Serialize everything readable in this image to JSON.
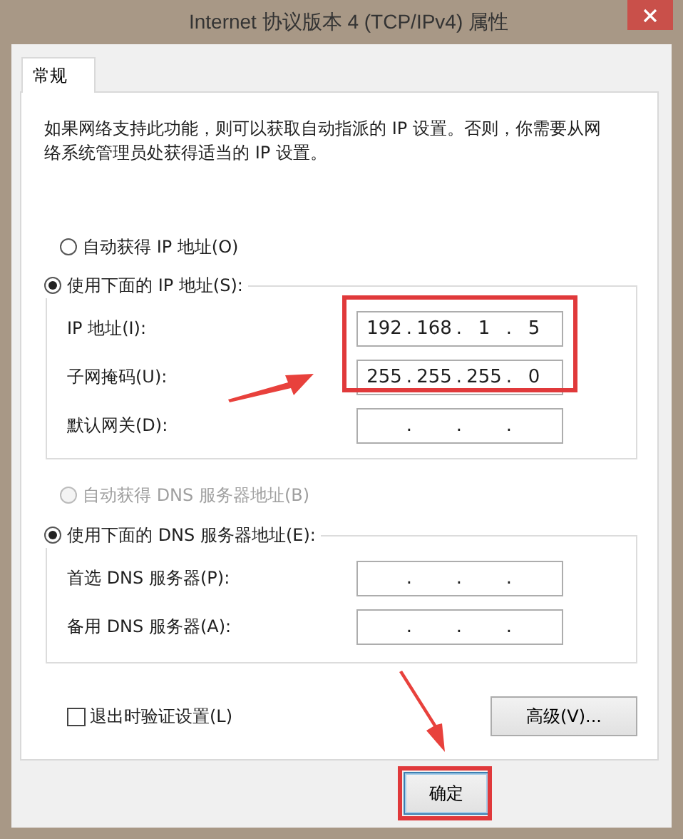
{
  "window": {
    "title": "Internet 协议版本 4 (TCP/IPv4) 属性"
  },
  "tabs": [
    {
      "label": "常规",
      "selected": true
    }
  ],
  "description": "如果网络支持此功能，则可以获取自动指派的 IP 设置。否则，你需要从网络系统管理员处获得适当的 IP 设置。",
  "ip_auto": {
    "label": "自动获得 IP 地址(O)",
    "selected": false,
    "disabled": false
  },
  "ip_manual": {
    "label": "使用下面的 IP 地址(S):",
    "selected": true,
    "disabled": false
  },
  "ip_fields": [
    {
      "label": "IP 地址(I):",
      "octets": [
        "192",
        "168",
        "1",
        "5"
      ],
      "separators": [
        ".",
        ".",
        "."
      ]
    },
    {
      "label": "子网掩码(U):",
      "octets": [
        "255",
        "255",
        "255",
        "0"
      ],
      "separators": [
        ".",
        ".",
        "."
      ]
    },
    {
      "label": "默认网关(D):",
      "separators": [
        ".",
        ".",
        "."
      ]
    }
  ],
  "dns_auto": {
    "label": "自动获得 DNS 服务器地址(B)",
    "selected": false,
    "disabled": true
  },
  "dns_manual": {
    "label": "使用下面的 DNS 服务器地址(E):",
    "selected": true,
    "disabled": false
  },
  "dns_fields": [
    {
      "label": "首选 DNS 服务器(P):",
      "separators": [
        ".",
        ".",
        "."
      ]
    },
    {
      "label": "备用 DNS 服务器(A):",
      "separators": [
        ".",
        ".",
        "."
      ]
    }
  ],
  "validate_checkbox": {
    "label": "退出时验证设置(L)",
    "checked": false
  },
  "advanced_button": {
    "label": "高级(V)..."
  },
  "ok_button": {
    "label": "确定",
    "default": true
  },
  "annotations": [
    {
      "kind": "box"
    },
    {
      "kind": "arrow"
    },
    {
      "kind": "arrow"
    },
    {
      "kind": "box"
    }
  ]
}
